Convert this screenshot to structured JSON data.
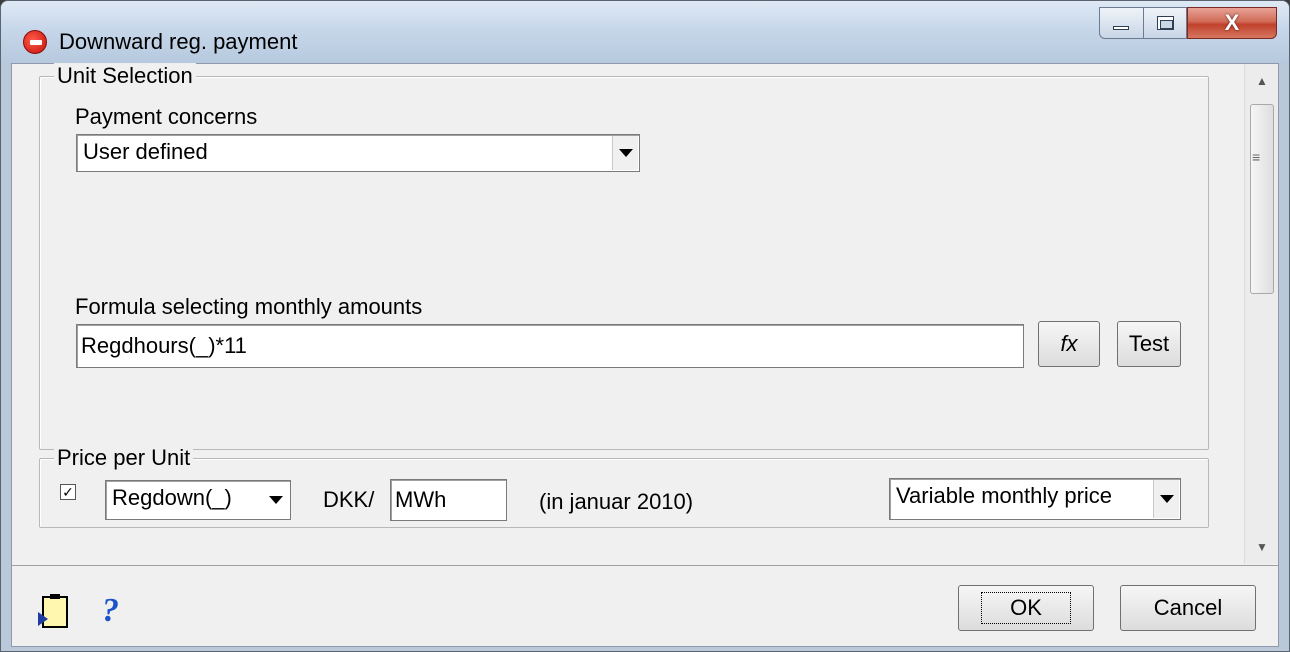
{
  "window": {
    "title": "Downward reg. payment",
    "close_glyph": "X"
  },
  "unit_selection": {
    "legend": "Unit Selection",
    "payment_concerns_label": "Payment concerns",
    "payment_concerns_value": "User defined",
    "formula_label": "Formula selecting monthly amounts",
    "formula_value": "Regdhours(_)*11",
    "fx_label": "fx",
    "test_label": "Test"
  },
  "price_per_unit": {
    "legend": "Price per Unit",
    "checked": true,
    "price_source": "Regdown(_)",
    "currency_label": "DKK/",
    "unit_value": "MWh",
    "date_note": "(in  januar 2010)",
    "price_mode": "Variable monthly price"
  },
  "footer": {
    "ok_label": "OK",
    "cancel_label": "Cancel"
  },
  "icons": {
    "app": "app-logo-icon",
    "clipboard": "clipboard-import-icon",
    "help": "help-icon"
  }
}
